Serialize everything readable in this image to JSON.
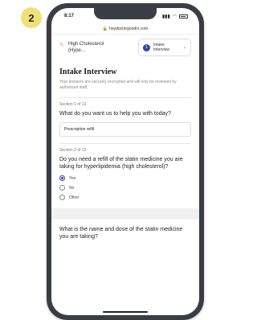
{
  "step_number": "2",
  "status_bar": {
    "time": "8:17",
    "signal": "▮▮▮",
    "wifi": "◠"
  },
  "url_bar": {
    "lock": "🔒",
    "url": "heydoctorgoodrx.com"
  },
  "header": {
    "brand": {
      "line1": "High Cholesterol",
      "line2": "(Hype..."
    },
    "dropdown": {
      "step_dot": "1",
      "line1": "Intake",
      "line2": "Interview",
      "chevron": "⌄"
    }
  },
  "page": {
    "title": "Intake Interview",
    "subtitle": "Your answers are securely encrypted and will only be reviewed by authorized staff."
  },
  "sections": [
    {
      "label": "Section 1 of 13",
      "question": "What do you want us to help you with today?",
      "answer": "Prescription refill"
    },
    {
      "label": "Section 2 of 13",
      "question": "Do you need a refill of the statin medicine you are taking for hyperlipidemia (high cholesterol)?",
      "options": [
        {
          "label": "Yes",
          "checked": true
        },
        {
          "label": "No",
          "checked": false
        },
        {
          "label": "Other",
          "checked": false
        }
      ]
    },
    {
      "question": "What is the name and dose of the statin medicine you are taking?"
    }
  ],
  "colors": {
    "accent": "#2e46a5",
    "badge": "#f1e07a",
    "phone_frame": "#3a3d44"
  }
}
